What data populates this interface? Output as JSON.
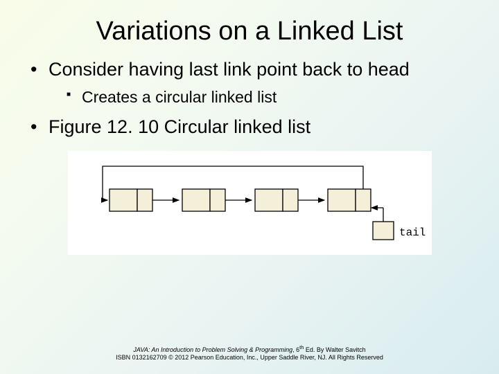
{
  "title": "Variations on a Linked List",
  "bullets": {
    "b1": "Consider having last link point back to head",
    "b1_sub": "Creates a circular linked list",
    "b2": "Figure 12. 10 Circular linked list"
  },
  "diagram": {
    "tail_label": "tail"
  },
  "footer": {
    "line1_italic": "JAVA: An Introduction to Problem Solving & Programming",
    "line1_rest": ", 6",
    "line1_sup": "th",
    "line1_after": " Ed. By Walter Savitch",
    "line2": "ISBN 0132162709 © 2012 Pearson Education, Inc., Upper Saddle River, NJ. All Rights Reserved"
  }
}
